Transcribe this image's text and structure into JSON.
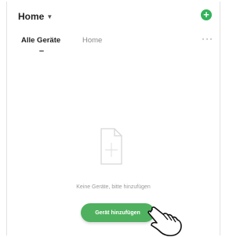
{
  "header": {
    "title": "Home",
    "title_chevron_icon": "chevron-down-icon",
    "add_icon": "plus-circle-icon"
  },
  "tabs": [
    {
      "label": "Alle Geräte",
      "active": true
    },
    {
      "label": "Home",
      "active": false
    }
  ],
  "more_icon": "more-horizontal-icon",
  "empty_state": {
    "icon": "empty-document-icon",
    "text": "Keine Geräte, bitte hinzufügen"
  },
  "add_device_button": {
    "label": "Gerät hinzufügen"
  },
  "colors": {
    "accent_green": "#4fb15f",
    "add_icon_green": "#33b35a"
  }
}
